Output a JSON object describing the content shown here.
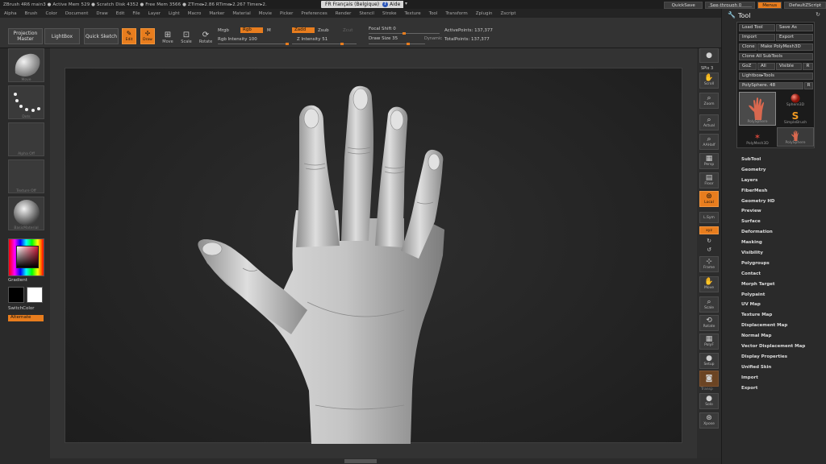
{
  "titlebar": {
    "status": "ZBrush 4R6      main3      ● Active Mem 529  ● Scratch Disk 4352  ● Free Mem 3566  ● ZTime▸2.86  RTime▸2.267  Timer▸2.",
    "language": "FR Français (Belgique)",
    "help": "Aide",
    "quicksave": "QuickSave",
    "see_through": "See-through  0",
    "menus": "Menus",
    "default_zscript": "DefaultZScript"
  },
  "menubar": [
    "Alpha",
    "Brush",
    "Color",
    "Document",
    "Draw",
    "Edit",
    "File",
    "Layer",
    "Light",
    "Macro",
    "Marker",
    "Material",
    "Movie",
    "Picker",
    "Preferences",
    "Render",
    "Stencil",
    "Stroke",
    "Texture",
    "Tool",
    "Transform",
    "Zplugin",
    "Zscript"
  ],
  "toolbar": {
    "projection_master": "Projection Master",
    "lightbox": "LightBox",
    "quick_sketch": "Quick Sketch",
    "edit": "Edit",
    "draw": "Draw",
    "move": "Move",
    "scale": "Scale",
    "rotate": "Rotate",
    "mrgb": "Mrgb",
    "rgb": "Rgb",
    "m": "M",
    "rgb_intensity": "Rgb Intensity 100",
    "zadd": "Zadd",
    "zsub": "Zsub",
    "zcut": "Zcut",
    "z_intensity": "Z Intensity 51",
    "focal_shift": "Focal Shift 0",
    "draw_size": "Draw Size 35",
    "dynamic": "Dynamic",
    "active_points": "ActivePoints: 137,377",
    "total_points": "TotalPoints: 137,377"
  },
  "left": {
    "brush_label": "Move",
    "stroke_label": "Dots",
    "alpha_label": "Alpha Off",
    "texture_label": "Texture Off",
    "material_label": "BasicMaterial",
    "gradient": "Gradient",
    "switch_color": "SwitchColor",
    "alternate": "Alternate"
  },
  "shelf": {
    "bpr": "BPR",
    "spix": "SPix 3",
    "scroll": "Scroll",
    "zoom": "Zoom",
    "actual": "Actual",
    "aahalf": "AAHalf",
    "persp": "Persp",
    "floor": "Floor",
    "local": "Local",
    "lsym": "L.Sym",
    "xyz": "xyz",
    "frame": "Frame",
    "move": "Move",
    "scale": "Scale",
    "rotate": "Rotate",
    "polyf": "PolyF",
    "setup": "Setup",
    "transp": "Transp",
    "solo": "Solo",
    "xpose": "Xpose"
  },
  "tool": {
    "title": "Tool",
    "load_tool": "Load Tool",
    "save_as": "Save As",
    "import": "Import",
    "export": "Export",
    "clone": "Clone",
    "make_polymesh": "Make PolyMesh3D",
    "clone_all": "Clone All SubTools",
    "goz": "GoZ",
    "all": "All",
    "visible": "Visible",
    "r": "R",
    "lightbox_tools": "Lightbox▸Tools",
    "current_tool": "PolySphere. 48",
    "thumbs": [
      "PolySphere",
      "Sphere3D",
      "SimpleBrush",
      "PolyMesh3D",
      "PolySphere"
    ],
    "sections": [
      "SubTool",
      "Geometry",
      "Layers",
      "FiberMesh",
      "Geometry HD",
      "Preview",
      "Surface",
      "Deformation",
      "Masking",
      "Visibility",
      "Polygroups",
      "Contact",
      "Morph Target",
      "Polypaint",
      "UV Map",
      "Texture Map",
      "Displacement Map",
      "Normal Map",
      "Vector Displacement Map",
      "Display Properties",
      "Unified Skin",
      "Import",
      "Export"
    ]
  },
  "colors": {
    "accent": "#e87d1e",
    "panel": "#2a2a2a",
    "canvas": "#242424"
  }
}
